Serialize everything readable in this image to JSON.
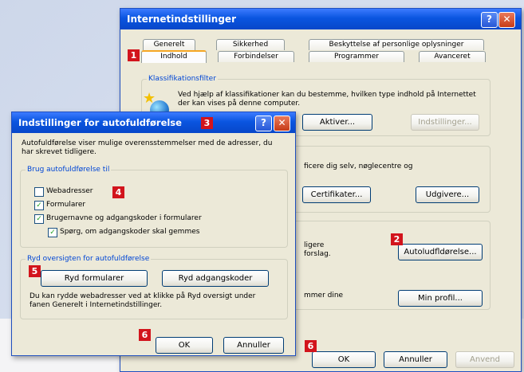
{
  "main_window": {
    "title": "Internetindstillinger",
    "help": "?",
    "close": "✕",
    "tabs_row1": [
      "Generelt",
      "Sikkerhed",
      "Beskyttelse af personlige oplysninger"
    ],
    "tabs_row2": [
      "Indhold",
      "Forbindelser",
      "Programmer",
      "Avanceret"
    ],
    "group_classification": "Klassifikationsfilter",
    "classification_text": "Ved hjælp af klassifikationer kan du bestemme, hvilken type indhold på Internettet der kan vises på denne computer.",
    "activate_button": "Aktiver...",
    "settings_button": "Indstillinger...",
    "cert_text": "ficere dig selv, nøglecentre og",
    "certificates_button": "Certifikater...",
    "publishers_button": "Udgivere...",
    "personal_text1": "ligere",
    "personal_text2": "forslag.",
    "autocomplete_button": "Autoludfldørelse...",
    "personal_text3": "mmer dine",
    "profile_button": "Min profil...",
    "ok": "OK",
    "cancel": "Annuller",
    "apply": "Anvend"
  },
  "dialog": {
    "title": "Indstillinger for autofuldførelse",
    "help": "?",
    "close": "✕",
    "intro": "Autofuldførelse viser mulige overensstemmelser med de adresser, du har skrevet tidligere.",
    "group_use": "Brug autofuldførelse til",
    "options": [
      {
        "label": "Webadresser",
        "checked": false
      },
      {
        "label": "Formularer",
        "checked": true
      },
      {
        "label": "Brugernavne og adgangskoder i formularer",
        "checked": true
      },
      {
        "label": "Spørg, om adgangskoder skal gemmes",
        "checked": true
      }
    ],
    "group_clear": "Ryd oversigten for autofuldførelse",
    "clear_forms": "Ryd formularer",
    "clear_passwords": "Ryd adgangskoder",
    "note": "Du kan rydde webadresser ved at klikke på Ryd oversigt under fanen Generelt i Internetindstillinger.",
    "ok": "OK",
    "cancel": "Annuller"
  },
  "badges": {
    "b1": "1",
    "b2": "2",
    "b3": "3",
    "b4": "4",
    "b5": "5",
    "b6a": "6",
    "b6b": "6"
  },
  "colors": {
    "titlebar": "#0a55e0",
    "badge": "#d2141c",
    "group_title": "#0046d5"
  }
}
